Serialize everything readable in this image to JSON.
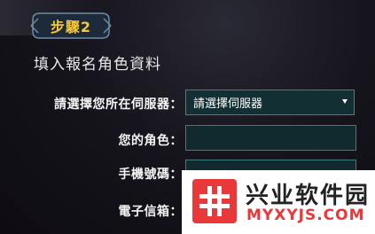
{
  "step": {
    "label": "步驟2"
  },
  "section": {
    "title": "填入報名角色資料"
  },
  "form": {
    "server": {
      "label": "請選擇您所在伺服器：",
      "selected": "請選擇伺服器"
    },
    "role": {
      "label": "您的角色：",
      "value": ""
    },
    "phone": {
      "label": "手機號碼：",
      "value": ""
    },
    "email": {
      "label": "電子信箱：",
      "value": ""
    }
  },
  "watermark": {
    "title": "兴业软件园",
    "url": "MYXYJS.COM"
  },
  "colors": {
    "accent": "#f1c63a",
    "field_border": "#3d7c80",
    "field_bg": "#102a2e",
    "watermark_red": "#e8383a"
  },
  "icons": {
    "select_arrow": "chevron-down-icon",
    "watermark_logo": "hash-logo-icon"
  }
}
